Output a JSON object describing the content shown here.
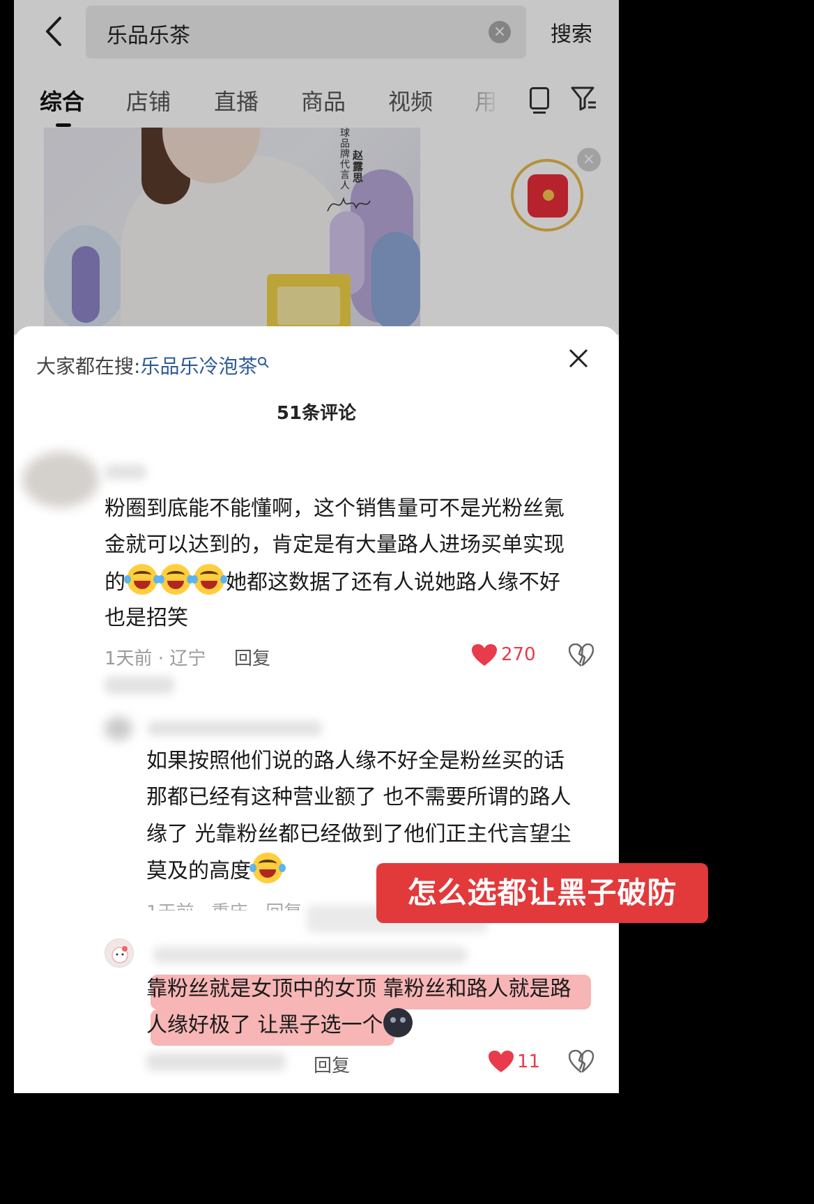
{
  "search": {
    "query": "乐品乐茶",
    "submit_label": "搜索"
  },
  "tabs": [
    {
      "label": "综合",
      "active": true
    },
    {
      "label": "店铺",
      "active": false
    },
    {
      "label": "直播",
      "active": false
    },
    {
      "label": "商品",
      "active": false
    },
    {
      "label": "视频",
      "active": false
    },
    {
      "label": "用户",
      "active": false
    }
  ],
  "banner": {
    "line_a": "赵露思",
    "line_b": "球品牌代言人"
  },
  "sheet": {
    "hint_prefix": "大家都在搜:",
    "hint_term": "乐品乐冷泡茶",
    "comment_count": "51条评论"
  },
  "comments": [
    {
      "lines": [
        "粉圈到底能不能懂啊，这个销售量可不是光粉丝氪",
        "金就可以达到的，肯定是有大量路人进场买单实现",
        "她都这数据了还有人说她路人缘不好",
        "也是招笑"
      ],
      "line3_prefix": "的",
      "time": "1天前",
      "location": "辽宁",
      "reply_label": "回复",
      "likes": "270"
    },
    {
      "lines": [
        "如果按照他们说的路人缘不好全是粉丝买的话",
        "那都已经有这种营业额了 也不需要所谓的路人",
        "缘了 光靠粉丝都已经做到了他们正主代言望尘",
        "莫及的高度"
      ],
      "time": "1天前",
      "location": "重庆",
      "reply_label": "回复"
    },
    {
      "lines": [
        "靠粉丝就是女顶中的女顶 靠粉丝和路人就是路",
        "人缘好极了 让黑子选一个"
      ],
      "reply_label": "回复",
      "likes": "11"
    }
  ],
  "overlay_caption": "怎么选都让黑子破防",
  "colors": {
    "accent_red": "#e2393b",
    "like_red": "#e83b4b",
    "link_blue": "#2c5a93",
    "highlight": "#f07878"
  },
  "icons": [
    "back-icon",
    "clear-icon",
    "device-icon",
    "filter-icon",
    "red-packet-icon",
    "close-icon",
    "heart-icon",
    "dislike-icon"
  ]
}
